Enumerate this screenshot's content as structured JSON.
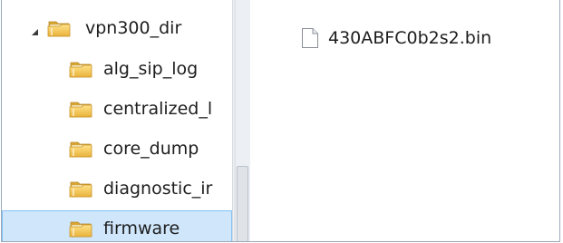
{
  "navigation_tree": {
    "items": [
      {
        "label": "vpn300_dir",
        "icon": "folder-icon",
        "expanded": true
      },
      {
        "label": "alg_sip_log",
        "icon": "folder-icon"
      },
      {
        "label": "centralized_l",
        "icon": "folder-icon"
      },
      {
        "label": "core_dump",
        "icon": "folder-icon"
      },
      {
        "label": "diagnostic_ir",
        "icon": "folder-icon"
      },
      {
        "label": "firmware",
        "icon": "folder-icon",
        "selected": true
      }
    ]
  },
  "content": {
    "files": [
      {
        "name": "430ABFC0b2s2.bin",
        "icon": "file-icon"
      }
    ]
  },
  "colors": {
    "selection_background": "#cfe6fb",
    "selection_border": "#84c1f5",
    "folder_yellow": "#f1c24a"
  }
}
